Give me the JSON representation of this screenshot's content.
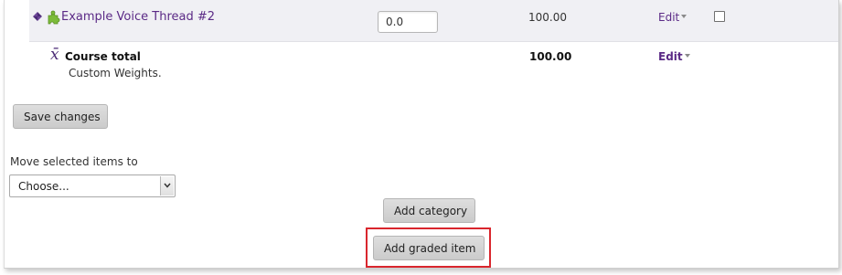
{
  "grade_item": {
    "name": "Example Voice Thread #2",
    "weight_value": "0.0",
    "max_grade": "100.00",
    "edit_label": "Edit",
    "icon": "puzzle-icon"
  },
  "course_total": {
    "symbol": "x̄",
    "label": "Course total",
    "subtitle": "Custom Weights.",
    "max_grade": "100.00",
    "edit_label": "Edit"
  },
  "buttons": {
    "save_changes": "Save changes",
    "add_category": "Add category",
    "add_graded_item": "Add graded item"
  },
  "move": {
    "label": "Move selected items to",
    "selected": "Choose..."
  },
  "colors": {
    "link": "#5b2a86",
    "highlight": "#d9262d",
    "row_background": "#f0f0f4"
  }
}
